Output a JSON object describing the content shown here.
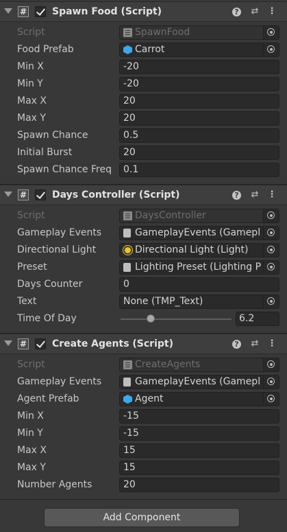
{
  "components": [
    {
      "title": "Spawn Food (Script)",
      "fields": [
        {
          "label": "Script",
          "value": "SpawnFood",
          "kind": "script",
          "disabled": true
        },
        {
          "label": "Food Prefab",
          "value": "Carrot",
          "kind": "prefab"
        },
        {
          "label": "Min X",
          "value": "-20",
          "kind": "text"
        },
        {
          "label": "Min Y",
          "value": "-20",
          "kind": "text"
        },
        {
          "label": "Max X",
          "value": "20",
          "kind": "text"
        },
        {
          "label": "Max Y",
          "value": "20",
          "kind": "text"
        },
        {
          "label": "Spawn Chance",
          "value": "0.5",
          "kind": "text"
        },
        {
          "label": "Initial Burst",
          "value": "20",
          "kind": "text"
        },
        {
          "label": "Spawn Chance Freq",
          "value": "0.1",
          "kind": "text"
        }
      ]
    },
    {
      "title": "Days Controller (Script)",
      "fields": [
        {
          "label": "Script",
          "value": "DaysController",
          "kind": "script",
          "disabled": true
        },
        {
          "label": "Gameplay Events",
          "value": "GameplayEvents (Gamepl",
          "kind": "so"
        },
        {
          "label": "Directional Light",
          "value": "Directional Light (Light)",
          "kind": "light"
        },
        {
          "label": "Preset",
          "value": "Lighting Preset (Lighting P",
          "kind": "so"
        },
        {
          "label": "Days Counter",
          "value": "0",
          "kind": "text"
        },
        {
          "label": "Text",
          "value": "None (TMP_Text)",
          "kind": "none"
        },
        {
          "label": "Time Of Day",
          "value": "6.2",
          "kind": "slider",
          "level": 0.27
        }
      ]
    },
    {
      "title": "Create Agents (Script)",
      "fields": [
        {
          "label": "Script",
          "value": "CreateAgents",
          "kind": "script",
          "disabled": true
        },
        {
          "label": "Gameplay Events",
          "value": "GameplayEvents (Gamepl",
          "kind": "so"
        },
        {
          "label": "Agent Prefab",
          "value": "Agent",
          "kind": "prefab"
        },
        {
          "label": "Min X",
          "value": "-15",
          "kind": "text"
        },
        {
          "label": "Min Y",
          "value": "-15",
          "kind": "text"
        },
        {
          "label": "Max X",
          "value": "15",
          "kind": "text"
        },
        {
          "label": "Max Y",
          "value": "15",
          "kind": "text"
        },
        {
          "label": "Number Agents",
          "value": "20",
          "kind": "text"
        }
      ]
    }
  ],
  "add_component_label": "Add Component",
  "icons": {
    "help": "help-icon",
    "presets": "presets-icon",
    "menu": "kebab-menu-icon",
    "script": "script-hash-icon"
  }
}
